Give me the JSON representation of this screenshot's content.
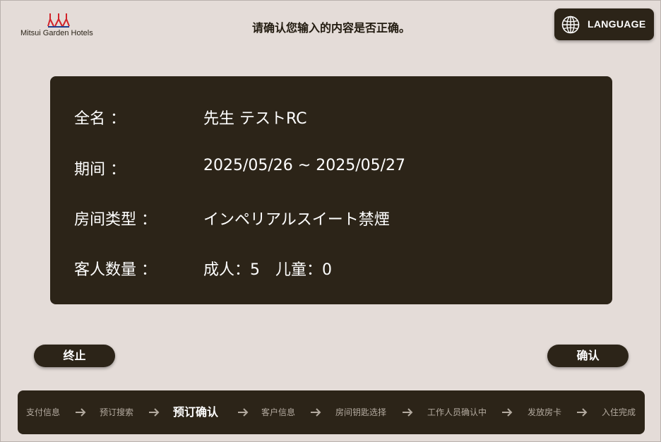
{
  "header": {
    "logo_text": "Mitsui Garden Hotels",
    "title": "请确认您输入的内容是否正确。",
    "language_label": "LANGUAGE"
  },
  "info": {
    "rows": [
      {
        "label": "全名 ：",
        "value": "先生 テストRC"
      },
      {
        "label": "期间 ：",
        "value": "2025/05/26 ~ 2025/05/27"
      },
      {
        "label": "房间类型 ：",
        "value": "インペリアルスイート禁煙"
      },
      {
        "label": "客人数量 ：",
        "value": "成人：5　儿童：0"
      }
    ]
  },
  "actions": {
    "cancel_label": "终止",
    "confirm_label": "确认"
  },
  "progress": {
    "steps": [
      {
        "label": "支付信息",
        "active": false
      },
      {
        "label": "预订搜索",
        "active": false
      },
      {
        "label": "预订确认",
        "active": true
      },
      {
        "label": "客户信息",
        "active": false
      },
      {
        "label": "房间钥匙选择",
        "active": false
      },
      {
        "label": "工作人员确认中",
        "active": false
      },
      {
        "label": "发放房卡",
        "active": false
      },
      {
        "label": "入住完成",
        "active": false
      }
    ]
  },
  "colors": {
    "background": "#e4dcd8",
    "panel": "#2c2418",
    "logo_red": "#d2232a",
    "logo_blue": "#1f3f8f"
  }
}
